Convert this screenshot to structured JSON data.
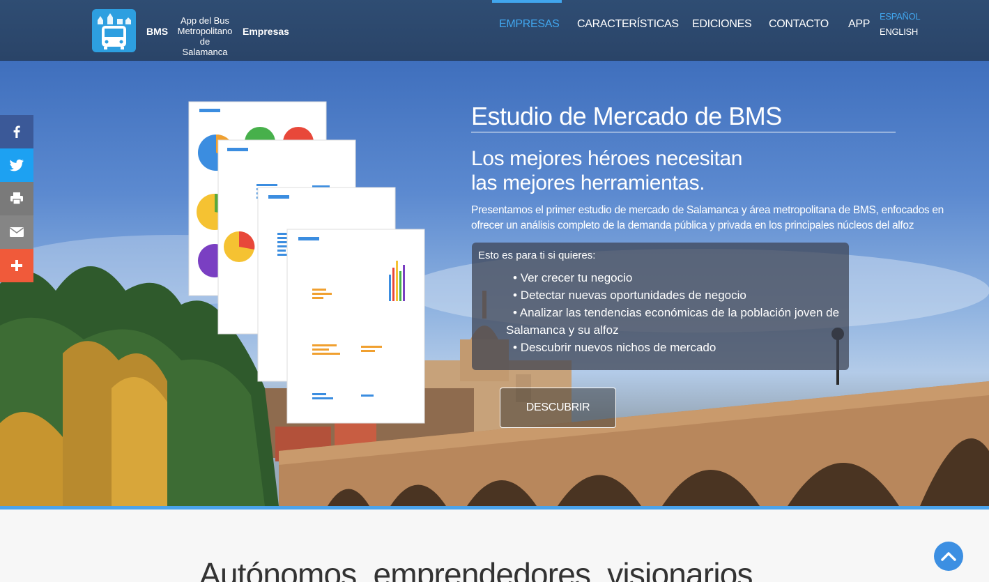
{
  "header": {
    "brand_short": "BMS",
    "brand_app_lines": [
      "App del Bus",
      "Metropolitano",
      "de Salamanca"
    ],
    "brand_section": "Empresas",
    "nav": [
      {
        "label": "EMPRESAS",
        "active": true
      },
      {
        "label": "CARACTERÍSTICAS",
        "active": false
      },
      {
        "label": "EDICIONES",
        "active": false
      },
      {
        "label": "CONTACTO",
        "active": false
      },
      {
        "label": "APP",
        "active": false
      }
    ],
    "languages": [
      {
        "label": "ESPAÑOL",
        "active": true
      },
      {
        "label": "ENGLISH",
        "active": false
      }
    ]
  },
  "hero": {
    "title": "Estudio de Mercado de BMS",
    "subtitle_lines": [
      "Los mejores héroes necesitan",
      "las mejores herramientas."
    ],
    "description": "Presentamos el primer estudio de mercado de Salamanca y área metropolitana de BMS, enfocados en ofrecer un análisis completo de la demanda pública y privada en los principales núcleos del alfoz",
    "benefits_intro": "Esto es para ti si quieres:",
    "benefits": [
      "Ver crecer tu negocio",
      "Detectar nuevas oportunidades de negocio",
      "Analizar las tendencias económicas de la población joven de Salamanca y su alfoz",
      "Descubrir nuevos nichos de mercado"
    ],
    "cta_label": "DESCUBRIR"
  },
  "social": [
    {
      "name": "facebook-icon",
      "color": "#3b5998"
    },
    {
      "name": "twitter-icon",
      "color": "#1da1f2"
    },
    {
      "name": "print-icon",
      "color": "#7a7a7a"
    },
    {
      "name": "email-icon",
      "color": "#858585"
    },
    {
      "name": "plus-icon",
      "color": "#f05a3a"
    }
  ],
  "section2": {
    "title": "Autónomos, emprendedores, visionarios..."
  },
  "colors": {
    "header_bg": "#2c4870",
    "accent": "#41a6ee"
  }
}
